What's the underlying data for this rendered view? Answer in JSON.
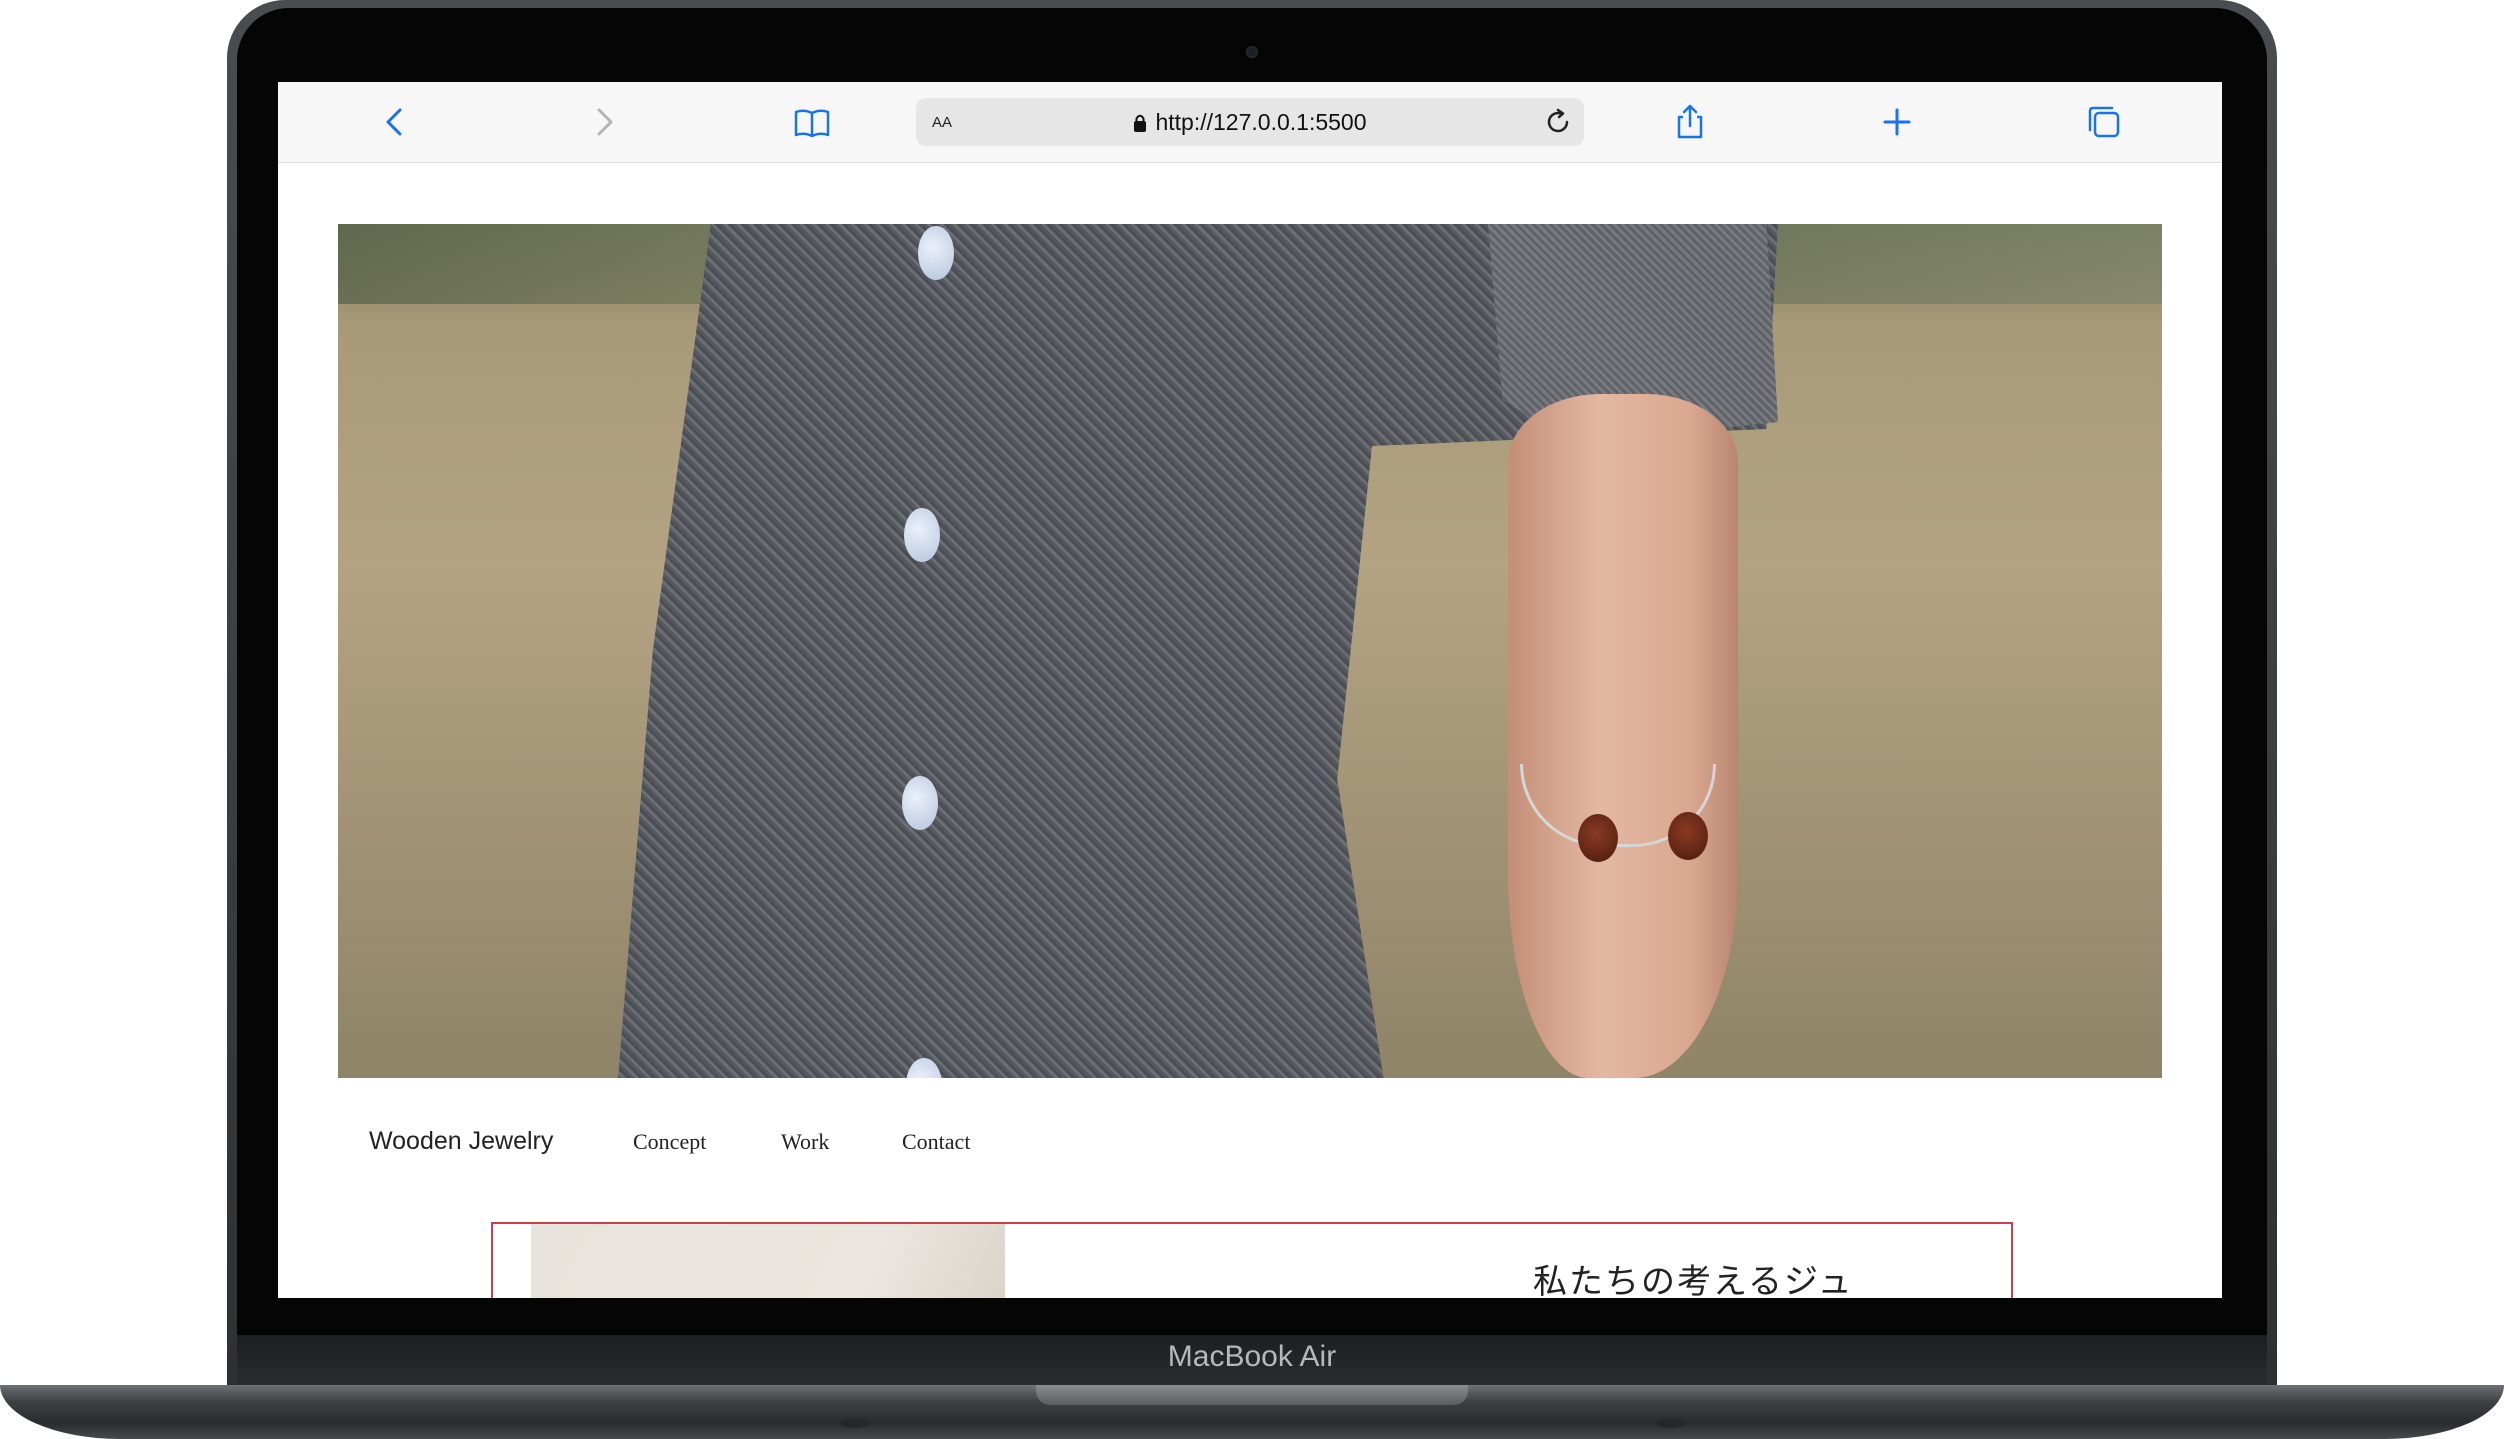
{
  "device": {
    "label": "MacBook Air"
  },
  "browser": {
    "reader_label": "AA",
    "url": "http://127.0.0.1:5500"
  },
  "site": {
    "brand": "Wooden Jewelry",
    "nav": [
      "Concept",
      "Work",
      "Contact"
    ],
    "concept_title": "私たちの考えるジュ"
  },
  "colors": {
    "accent": "#1a73e8",
    "concept_border": "#c9404a"
  },
  "icons": {
    "back": "chevron-left-icon",
    "forward": "chevron-right-icon",
    "bookmarks": "book-icon",
    "lock": "lock-icon",
    "reload": "reload-icon",
    "share": "share-icon",
    "new_tab": "plus-icon",
    "tabs": "tabs-icon"
  }
}
